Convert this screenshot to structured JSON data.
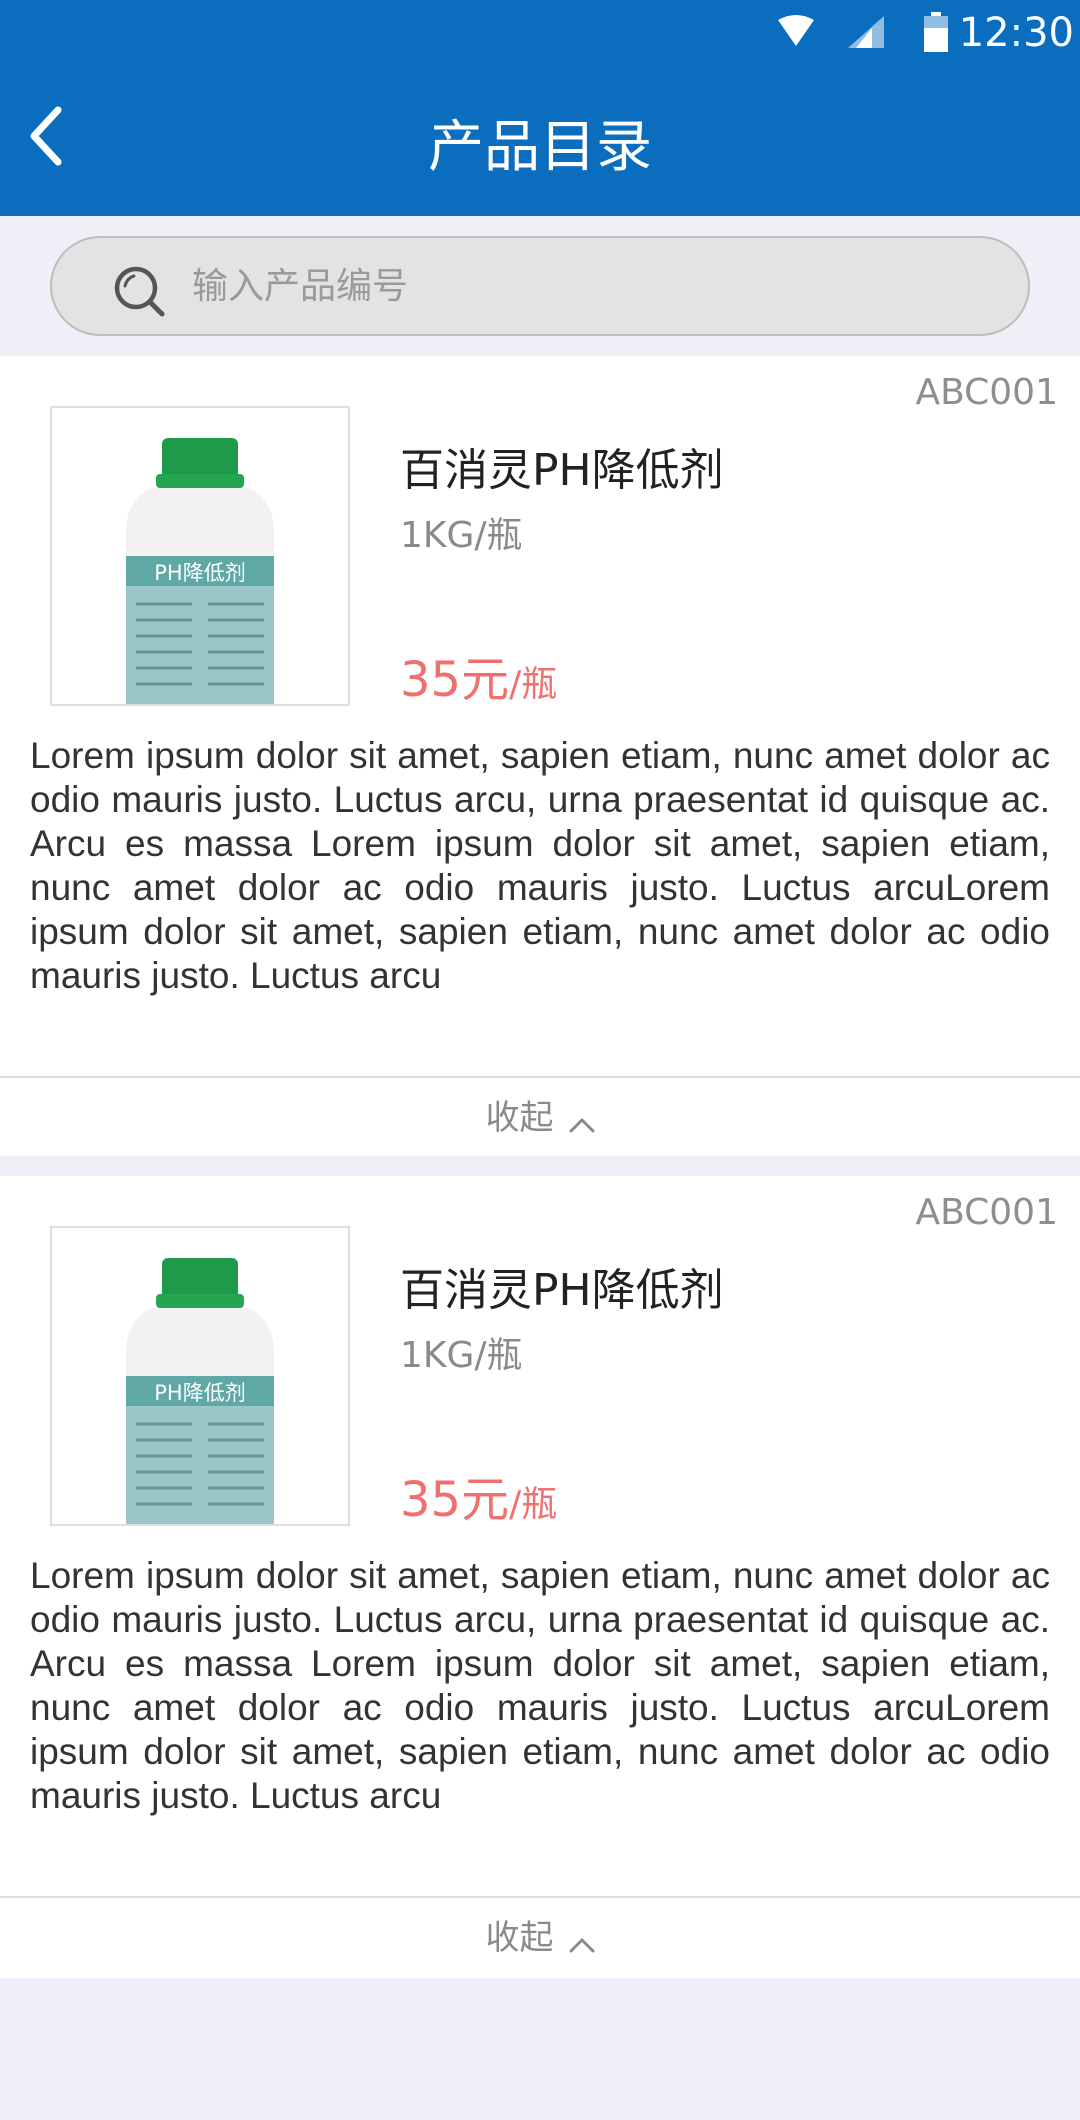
{
  "status_bar": {
    "time": "12:30",
    "icons": [
      "wifi-icon",
      "signal-icon",
      "battery-icon"
    ]
  },
  "header": {
    "title": "产品目录",
    "back_icon": "chevron-left-icon"
  },
  "search": {
    "placeholder": "输入产品编号",
    "icon": "search-icon"
  },
  "colors": {
    "primary": "#0a6dbd",
    "price": "#f07070",
    "background": "#efeff7"
  },
  "products": [
    {
      "code": "ABC001",
      "name": "百消灵PH降低剂",
      "spec": "1KG/瓶",
      "price": "35元",
      "price_unit": "/瓶",
      "label_text": "PH降低剂",
      "description": "Lorem ipsum dolor sit amet, sapien etiam, nunc amet dolor ac odio mauris justo. Luctus arcu, urna praesentat id quisque ac. Arcu es massa Lorem ipsum dolor sit amet, sapien etiam, nunc amet dolor ac odio mauris justo. Luctus arcuLorem ipsum dolor sit amet, sapien etiam, nunc amet dolor ac odio mauris justo. Luctus arcu",
      "toggle_label": "收起"
    },
    {
      "code": "ABC001",
      "name": "百消灵PH降低剂",
      "spec": "1KG/瓶",
      "price": "35元",
      "price_unit": "/瓶",
      "label_text": "PH降低剂",
      "description": "Lorem ipsum dolor sit amet, sapien etiam, nunc amet dolor ac odio mauris justo. Luctus arcu, urna praesentat id quisque ac. Arcu es massa Lorem ipsum dolor sit amet, sapien etiam, nunc amet dolor ac odio mauris justo. Luctus arcuLorem ipsum dolor sit amet, sapien etiam, nunc amet dolor ac odio mauris justo. Luctus arcu",
      "toggle_label": "收起"
    }
  ]
}
